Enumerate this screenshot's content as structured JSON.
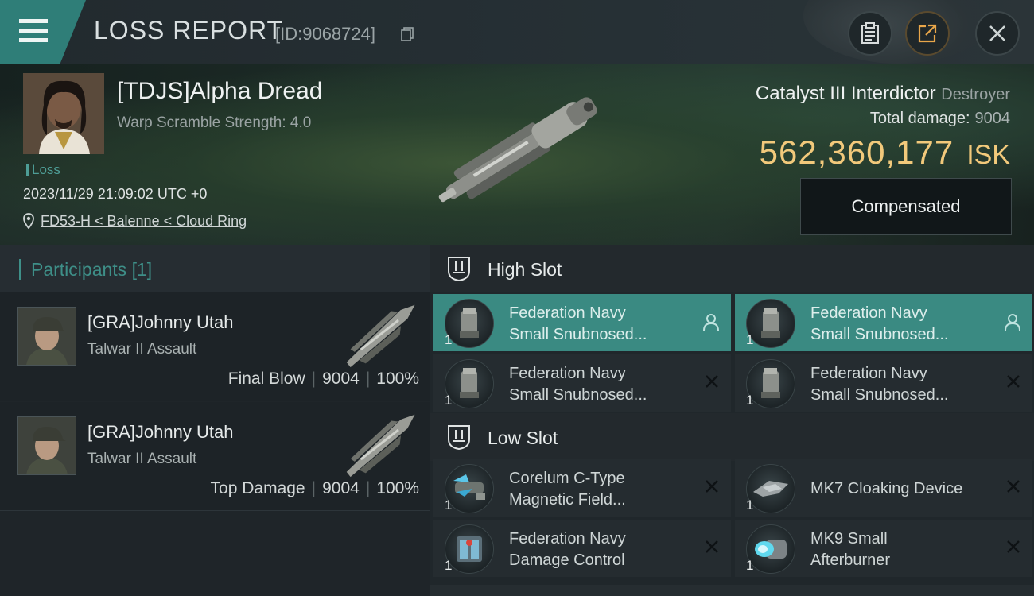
{
  "header": {
    "title": "LOSS REPORT",
    "report_id": "[ID:9068724]"
  },
  "victim": {
    "name": "[TDJS]Alpha Dread",
    "detail": "Warp Scramble Strength: 4.0",
    "tag": "Loss",
    "datetime": "2023/11/29 21:09:02 UTC +0",
    "location": "FD53-H < Balenne < Cloud Ring"
  },
  "ship": {
    "name": "Catalyst III Interdictor",
    "class": "Destroyer",
    "damage_label": "Total damage:",
    "damage_value": "9004",
    "isk_value": "562,360,177",
    "isk_unit": "ISK",
    "status_button": "Compensated"
  },
  "participants": {
    "title": "Participants",
    "count": "[1]",
    "rows": [
      {
        "name": "[GRA]Johnny Utah",
        "ship": "Talwar II Assault",
        "role": "Final Blow",
        "damage": "9004",
        "percent": "100%"
      },
      {
        "name": "[GRA]Johnny Utah",
        "ship": "Talwar II Assault",
        "role": "Top Damage",
        "damage": "9004",
        "percent": "100%"
      }
    ]
  },
  "slots": {
    "high": {
      "title": "High Slot",
      "modules": [
        {
          "line1": "Federation Navy",
          "line2": "Small Snubnosed...",
          "qty": "1",
          "action": "person-icon"
        },
        {
          "line1": "Federation Navy",
          "line2": "Small Snubnosed...",
          "qty": "1",
          "action": "person-icon"
        },
        {
          "line1": "Federation Navy",
          "line2": "Small Snubnosed...",
          "qty": "1",
          "action": "close-icon"
        },
        {
          "line1": "Federation Navy",
          "line2": "Small Snubnosed...",
          "qty": "1",
          "action": "close-icon"
        }
      ]
    },
    "low": {
      "title": "Low Slot",
      "modules": [
        {
          "line1": "Corelum C-Type",
          "line2": "Magnetic Field...",
          "qty": "1",
          "action": "close-icon"
        },
        {
          "line1": "MK7 Cloaking Device",
          "line2": "",
          "qty": "1",
          "action": "close-icon"
        },
        {
          "line1": "Federation Navy",
          "line2": "Damage Control",
          "qty": "1",
          "action": "close-icon"
        },
        {
          "line1": "MK9 Small",
          "line2": "Afterburner",
          "qty": "1",
          "action": "close-icon"
        }
      ]
    }
  },
  "colors": {
    "accent_teal": "#3a8a82",
    "isk_gold": "#f2c97b",
    "loss_tag": "#4e9d96"
  }
}
